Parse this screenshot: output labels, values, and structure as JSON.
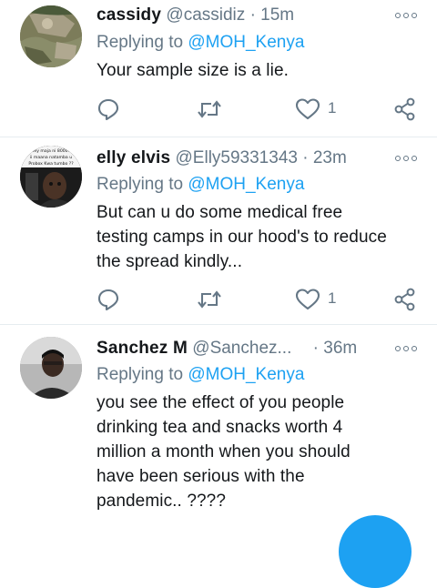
{
  "tweets": [
    {
      "name": "cassidy",
      "handle": "@cassidiz",
      "separator": "·",
      "time": "15m",
      "replying_prefix": "Replying to",
      "replying_to": "@MOH_Kenya",
      "text": "Your sample size is a lie.",
      "like_count": "1",
      "avatar_icon": "rocky-landscape-avatar"
    },
    {
      "name": "elly elvis",
      "handle": "@Elly59331343",
      "separator": "·",
      "time": "23m",
      "replying_prefix": "Replying to",
      "replying_to": "@MOH_Kenya",
      "text_lines": [
        "But can u do some medical free",
        "testing camps in our hood's to reduce",
        "the spread kindly..."
      ],
      "like_count": "1",
      "avatar_icon": "meme-photo-avatar",
      "avatar_caption_lines": [
        "hey maja ni 8000..",
        "ii maana natamba u",
        "Probox Kwa tumbo ??"
      ]
    },
    {
      "name": "Sanchez M",
      "handle": "@Sanchez...",
      "separator": "·",
      "time": "36m",
      "replying_prefix": "Replying to",
      "replying_to": "@MOH_Kenya",
      "text_lines": [
        "you see the effect of you people",
        "drinking tea and snacks worth 4",
        "million a month when you should",
        "have been serious with the",
        "pandemic.. ????"
      ],
      "avatar_icon": "person-photo-avatar"
    }
  ],
  "colors": {
    "accent": "#1da1f2",
    "secondary_text": "#657786",
    "divider": "#e6ecf0"
  }
}
